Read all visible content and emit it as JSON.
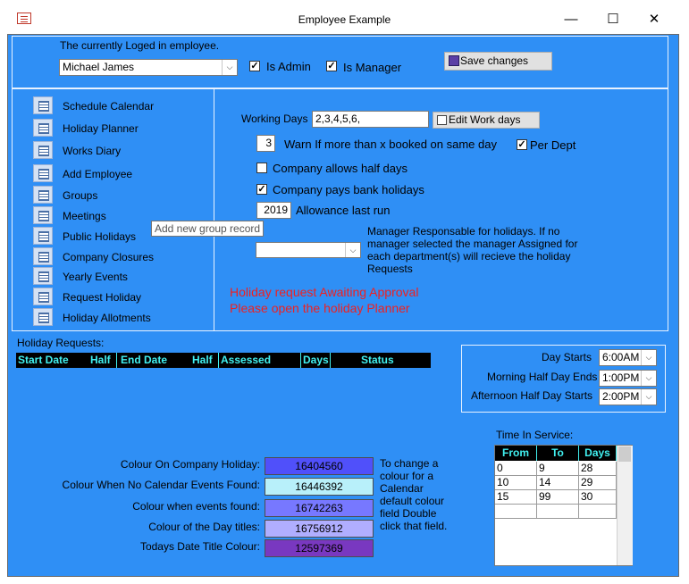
{
  "window": {
    "title": "Employee Example",
    "minimize": "—",
    "maximize": "☐",
    "close": "✕"
  },
  "top": {
    "logged_in_label": "The currently Loged in employee.",
    "employee_value": "Michael James",
    "is_admin_label": "Is Admin",
    "is_admin_checked": "✓",
    "is_manager_label": "Is Manager",
    "is_manager_checked": "✓",
    "save_label": "Save changes"
  },
  "nav": [
    {
      "label": "Schedule Calendar",
      "icon": "calendar-icon"
    },
    {
      "label": "Holiday Planner",
      "icon": "calendar-icon"
    },
    {
      "label": "Works Diary",
      "icon": "calendar-icon"
    },
    {
      "label": "Add Employee",
      "icon": "form-icon"
    },
    {
      "label": "Groups",
      "icon": "form-icon"
    },
    {
      "label": "Meetings",
      "icon": "clock-icon"
    },
    {
      "label": "Public Holidays",
      "icon": "globe-icon"
    },
    {
      "label": "Company Closures",
      "icon": "home-icon"
    },
    {
      "label": "Yearly Events",
      "icon": "form-icon"
    },
    {
      "label": "Request Holiday",
      "icon": "form-icon"
    },
    {
      "label": "Holiday Allotments",
      "icon": "form-icon"
    }
  ],
  "tooltip": "Add new group record",
  "settings": {
    "working_days_label": "Working Days",
    "working_days_value": "2,3,4,5,6,",
    "edit_work_days_label": "Edit Work days",
    "warn_value": "3",
    "warn_label": "Warn If more than x booked on same day",
    "per_dept_label": "Per Dept",
    "per_dept_checked": "✓",
    "half_days_label": "Company allows half days",
    "half_days_checked": "",
    "bank_holidays_label": "Company pays bank holidays",
    "bank_holidays_checked": "✓",
    "allowance_value": "2019",
    "allowance_label": "Allowance last run",
    "manager_note_1": "Manager Responsable for holidays. If no",
    "manager_note_2": "manager selected the manager Assigned for",
    "manager_note_3": "each department(s) will recieve the holiday",
    "manager_note_4": "Requests",
    "alert_1": "Holiday request Awaiting Approval",
    "alert_2": "Please open the holiday Planner"
  },
  "requests": {
    "title": "Holiday Requests:",
    "columns": [
      "Start Date",
      "Half",
      "End Date",
      "Half",
      "Assessed",
      "Days",
      "Status"
    ]
  },
  "times": {
    "day_starts_label": "Day Starts",
    "day_starts_value": "6:00AM",
    "morning_label": "Morning Half Day Ends",
    "morning_value": "1:00PM",
    "afternoon_label": "Afternoon Half Day Starts",
    "afternoon_value": "2:00PM"
  },
  "colours": [
    {
      "label": "Colour On Company Holiday:",
      "value": "16404560",
      "color": "#5050fa",
      "text_color": "#000000"
    },
    {
      "label": "Colour When No Calendar Events Found:",
      "value": "16446392",
      "color": "#b8f0fa",
      "text_color": "#000000"
    },
    {
      "label": "Colour when events found:",
      "value": "16742263",
      "color": "#7778ff",
      "text_color": "#000000"
    },
    {
      "label": "Colour of the Day titles:",
      "value": "16756912",
      "color": "#b0aeff",
      "text_color": "#000000"
    },
    {
      "label": "Todays Date Title Colour:",
      "value": "12597369",
      "color": "#7938c0",
      "text_color": "#000000"
    }
  ],
  "colour_note": [
    "To change a",
    "colour for a",
    "Calendar",
    "default colour",
    "field Double",
    "click that field."
  ],
  "service": {
    "title": "Time In Service:",
    "columns": [
      "From",
      "To",
      "Days"
    ],
    "rows": [
      [
        "0",
        "9",
        "28"
      ],
      [
        "10",
        "14",
        "29"
      ],
      [
        "15",
        "99",
        "30"
      ],
      [
        "",
        "",
        ""
      ]
    ]
  }
}
